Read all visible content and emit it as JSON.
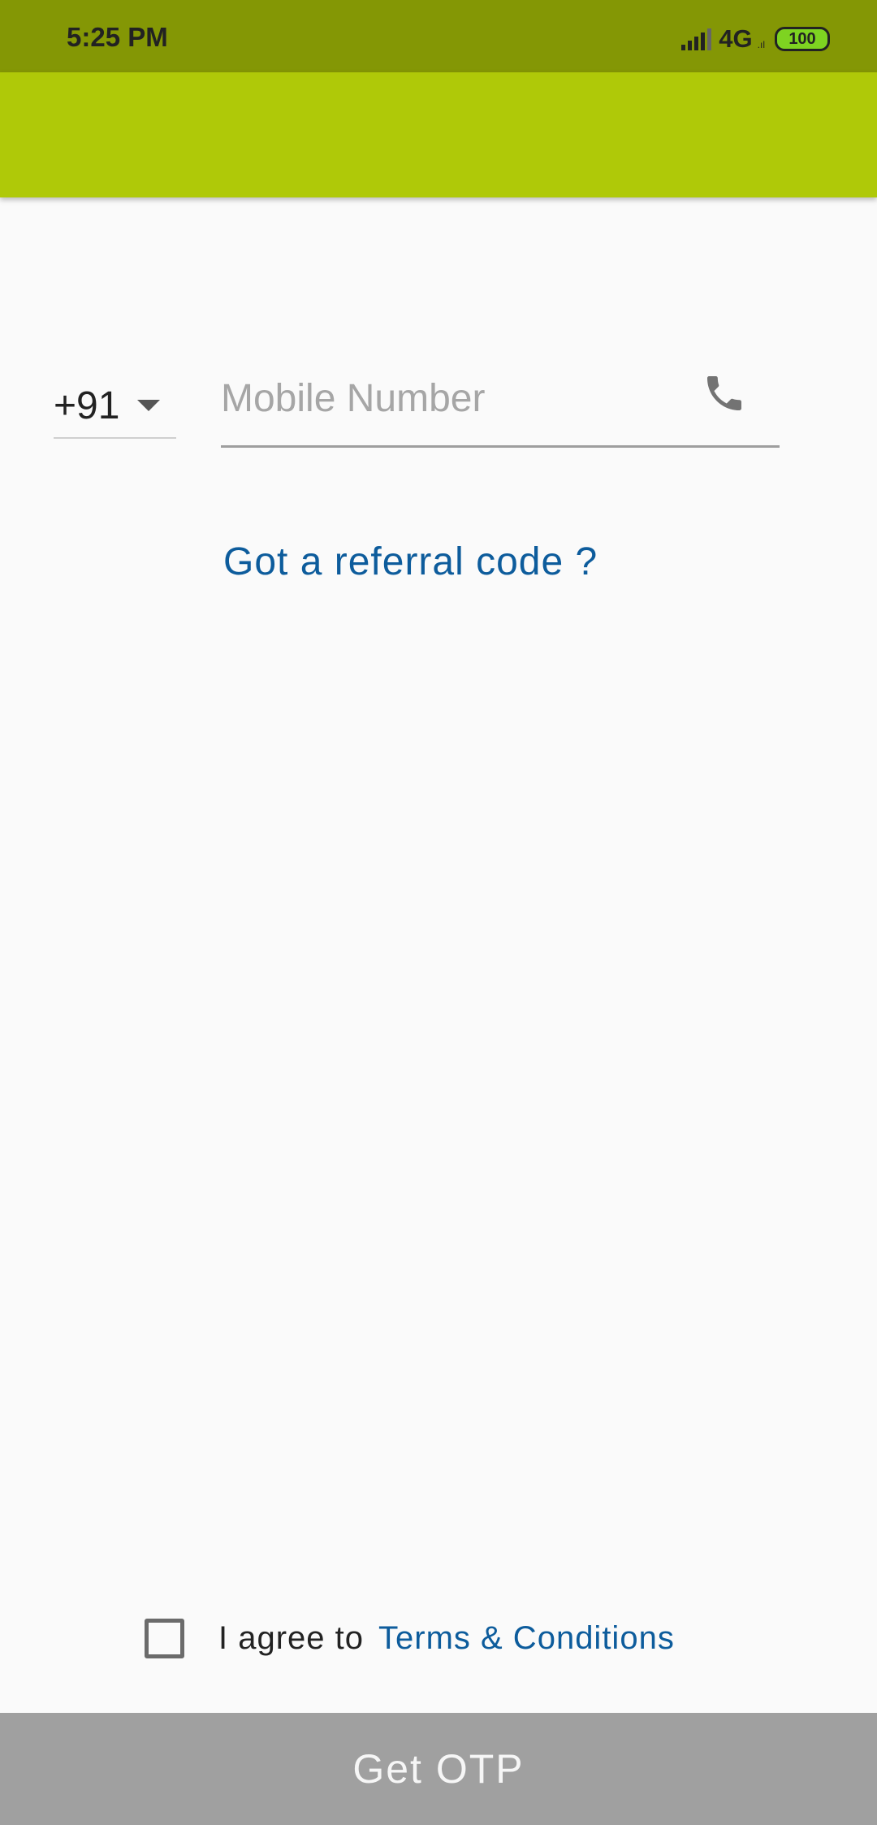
{
  "status_bar": {
    "time": "5:25 PM",
    "network": "4G",
    "network_sub": ".ıl",
    "battery": "100"
  },
  "form": {
    "country_code": "+91",
    "mobile_placeholder": "Mobile Number",
    "referral_link": "Got a referral code ?"
  },
  "terms": {
    "agree_text": "I agree to",
    "link_text": "Terms & Conditions"
  },
  "button": {
    "label": "Get OTP"
  },
  "colors": {
    "status_bar": "#849705",
    "app_bar": "#afc908",
    "link": "#0d5c9c",
    "button": "#a0a0a0"
  }
}
